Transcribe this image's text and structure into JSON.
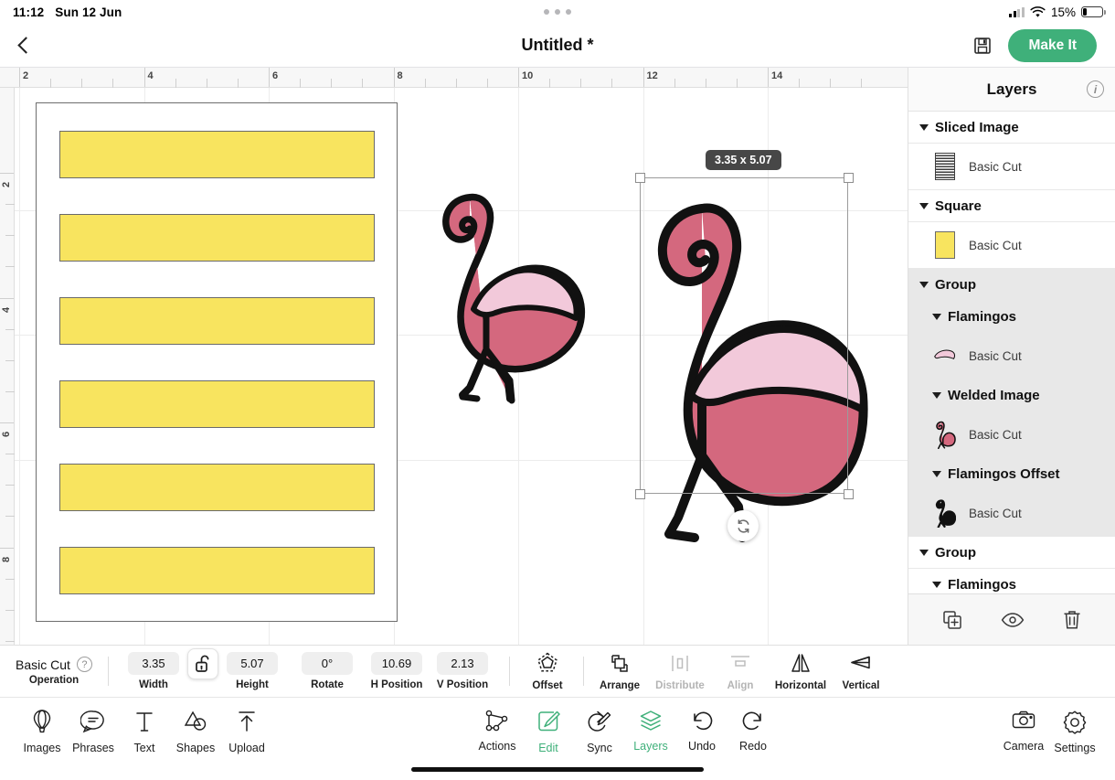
{
  "status_bar": {
    "time": "11:12",
    "date": "Sun 12 Jun",
    "battery_percent": "15%",
    "wifi_icon": "wifi-icon",
    "cellular_icon": "cellular-signal-icon",
    "battery_icon": "battery-icon"
  },
  "nav": {
    "back_icon": "back-chevron-icon",
    "title": "Untitled *",
    "save_icon": "save-disk-icon",
    "make_it_label": "Make It",
    "accent_color": "#3fb07a"
  },
  "rulers": {
    "horizontal_labels": [
      "2",
      "4",
      "6",
      "8",
      "10",
      "12",
      "14"
    ],
    "vertical_labels": [
      "2",
      "4",
      "6",
      "8"
    ]
  },
  "canvas": {
    "selection_size_badge": "3.35 x 5.07",
    "rotate_icon": "rotate-handle-icon",
    "mat_fill": "#ffffff",
    "rect_fill": "#F8E45F",
    "rect_stroke": "#6a6a6a",
    "flamingo_body": "#D4687E",
    "flamingo_wing": "#F2C9DA",
    "flamingo_outline": "#000000",
    "rect_count": 6
  },
  "layers": {
    "title": "Layers",
    "info_icon": "info-icon",
    "rows": [
      {
        "type": "group",
        "label": "Sliced Image",
        "indent": 0,
        "shaded": false,
        "icon": "disclosure-triangle-icon"
      },
      {
        "type": "item",
        "label": "Basic Cut",
        "thumb": "sliced-image-thumbnail",
        "shaded": false
      },
      {
        "type": "group",
        "label": "Square",
        "indent": 0,
        "shaded": false,
        "icon": "disclosure-triangle-icon"
      },
      {
        "type": "item",
        "label": "Basic Cut",
        "thumb": "yellow-square-thumbnail",
        "shaded": false
      },
      {
        "type": "group",
        "label": "Group",
        "indent": 0,
        "shaded": true,
        "icon": "disclosure-triangle-icon"
      },
      {
        "type": "group",
        "label": "Flamingos",
        "indent": 1,
        "shaded": true,
        "icon": "disclosure-triangle-icon"
      },
      {
        "type": "item",
        "label": "Basic Cut",
        "thumb": "wing-shape-thumbnail",
        "shaded": true
      },
      {
        "type": "group",
        "label": "Welded Image",
        "indent": 1,
        "shaded": true,
        "icon": "disclosure-triangle-icon"
      },
      {
        "type": "item",
        "label": "Basic Cut",
        "thumb": "flamingo-color-thumbnail",
        "shaded": true
      },
      {
        "type": "group",
        "label": "Flamingos Offset",
        "indent": 1,
        "shaded": true,
        "icon": "disclosure-triangle-icon"
      },
      {
        "type": "item",
        "label": "Basic Cut",
        "thumb": "flamingo-black-thumbnail",
        "shaded": true
      },
      {
        "type": "group",
        "label": "Group",
        "indent": 0,
        "shaded": false,
        "icon": "disclosure-triangle-icon"
      },
      {
        "type": "group",
        "label": "Flamingos",
        "indent": 1,
        "shaded": false,
        "icon": "disclosure-triangle-icon",
        "clipped": true
      }
    ],
    "footer": [
      {
        "name": "duplicate-layer-button",
        "icon": "duplicate-icon"
      },
      {
        "name": "visibility-toggle-button",
        "icon": "eye-icon"
      },
      {
        "name": "delete-layer-button",
        "icon": "trash-icon"
      }
    ]
  },
  "property_bar": {
    "operation_value": "Basic Cut",
    "operation_caption": "Operation",
    "help_icon": "question-mark-icon",
    "lock_icon": "unlocked-padlock-icon",
    "fields": [
      {
        "name": "width-field",
        "value": "3.35",
        "caption": "Width",
        "dim": false
      },
      {
        "name": "height-field",
        "value": "5.07",
        "caption": "Height",
        "dim": false
      },
      {
        "name": "rotate-field",
        "value": "0°",
        "caption": "Rotate",
        "dim": false
      },
      {
        "name": "h-position-field",
        "value": "10.69",
        "caption": "H Position",
        "dim": false
      },
      {
        "name": "v-position-field",
        "value": "2.13",
        "caption": "V Position",
        "dim": false
      }
    ],
    "tools": [
      {
        "name": "offset-tool",
        "caption": "Offset",
        "icon": "offset-pentagon-icon",
        "dim": false
      },
      {
        "name": "arrange-tool",
        "caption": "Arrange",
        "icon": "arrange-squares-icon",
        "dim": false
      },
      {
        "name": "distribute-tool",
        "caption": "Distribute",
        "icon": "distribute-icon",
        "dim": true
      },
      {
        "name": "align-tool",
        "caption": "Align",
        "icon": "align-icon",
        "dim": true
      },
      {
        "name": "flip-horizontal-tool",
        "caption": "Horizontal",
        "icon": "flip-horizontal-icon",
        "dim": false
      },
      {
        "name": "flip-vertical-tool",
        "caption": "Vertical",
        "icon": "flip-vertical-icon",
        "dim": false
      }
    ]
  },
  "tab_bar": {
    "left": [
      {
        "name": "tab-images",
        "caption": "Images",
        "icon": "hot-air-balloon-icon",
        "active": false
      },
      {
        "name": "tab-phrases",
        "caption": "Phrases",
        "icon": "speech-bubble-icon",
        "active": false
      },
      {
        "name": "tab-text",
        "caption": "Text",
        "icon": "text-t-icon",
        "active": false
      },
      {
        "name": "tab-shapes",
        "caption": "Shapes",
        "icon": "shapes-icon",
        "active": false
      },
      {
        "name": "tab-upload",
        "caption": "Upload",
        "icon": "upload-arrow-icon",
        "active": false
      }
    ],
    "center": [
      {
        "name": "tab-actions",
        "caption": "Actions",
        "icon": "actions-nodes-icon",
        "active": false
      },
      {
        "name": "tab-edit",
        "caption": "Edit",
        "icon": "edit-pencil-icon",
        "active": true
      },
      {
        "name": "tab-sync",
        "caption": "Sync",
        "icon": "sync-pen-icon",
        "active": false
      },
      {
        "name": "tab-layers",
        "caption": "Layers",
        "icon": "layers-stack-icon",
        "active": true
      },
      {
        "name": "tab-undo",
        "caption": "Undo",
        "icon": "undo-arrow-icon",
        "active": false
      },
      {
        "name": "tab-redo",
        "caption": "Redo",
        "icon": "redo-arrow-icon",
        "active": false
      }
    ],
    "right": [
      {
        "name": "tab-camera",
        "caption": "Camera",
        "icon": "camera-icon",
        "active": false
      },
      {
        "name": "tab-settings",
        "caption": "Settings",
        "icon": "gear-icon",
        "active": false
      }
    ]
  }
}
